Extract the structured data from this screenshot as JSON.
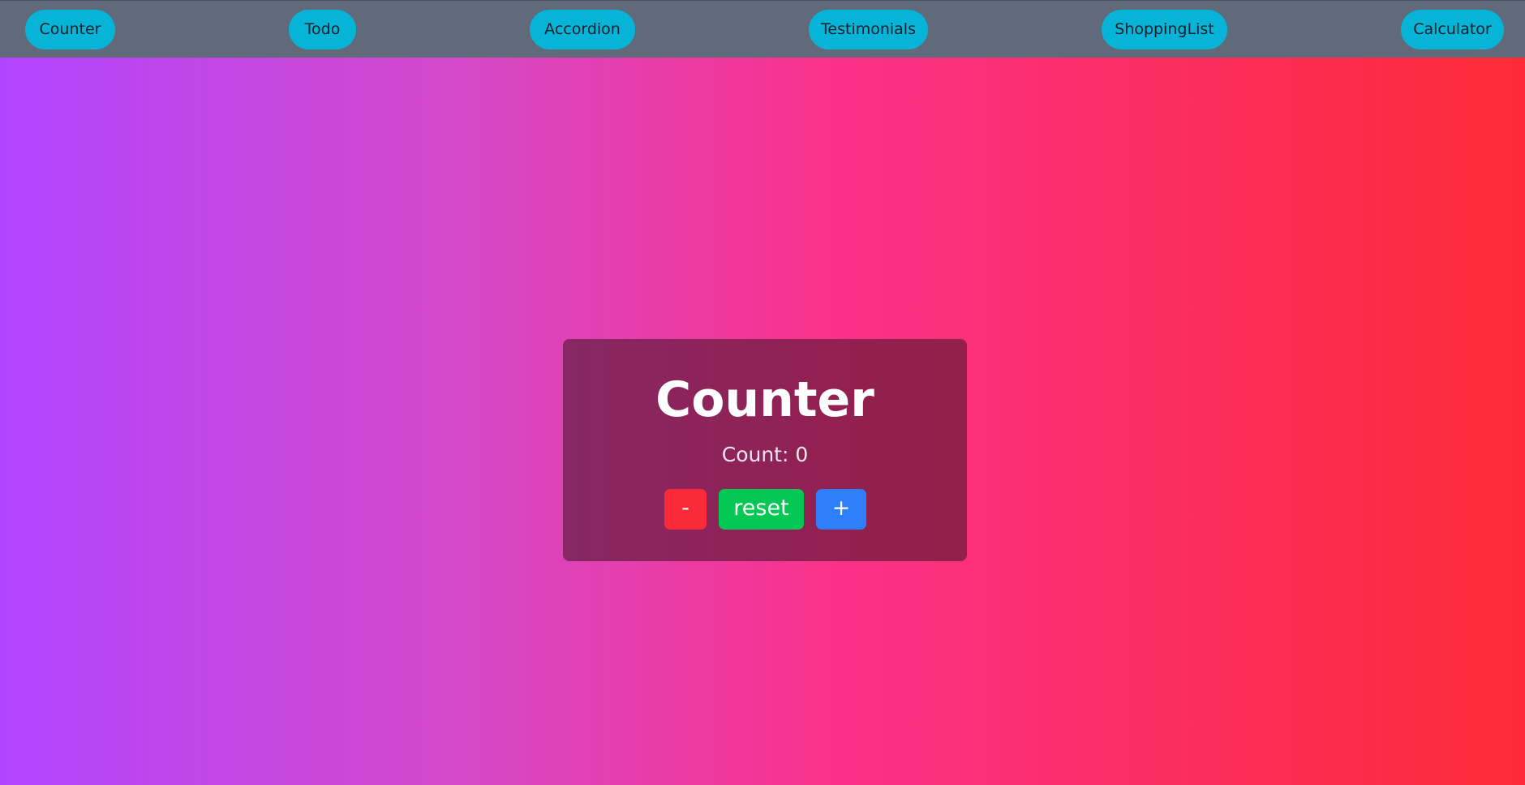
{
  "nav": {
    "items": [
      {
        "label": "Counter"
      },
      {
        "label": "Todo"
      },
      {
        "label": "Accordion"
      },
      {
        "label": "Testimonials"
      },
      {
        "label": "ShoppingList"
      },
      {
        "label": "Calculator"
      }
    ],
    "button_color": "#06b4d8",
    "bar_color": "#616a7a"
  },
  "counter": {
    "title": "Counter",
    "count_text": "Count: 0",
    "count": 0,
    "buttons": {
      "decrement": "-",
      "reset": "reset",
      "increment": "+"
    },
    "colors": {
      "decrement": "#fb2a3b",
      "reset": "#05c753",
      "increment": "#2d80fa"
    }
  },
  "background": {
    "gradient_start": "#b145ff",
    "gradient_end": "#fe2b36"
  }
}
